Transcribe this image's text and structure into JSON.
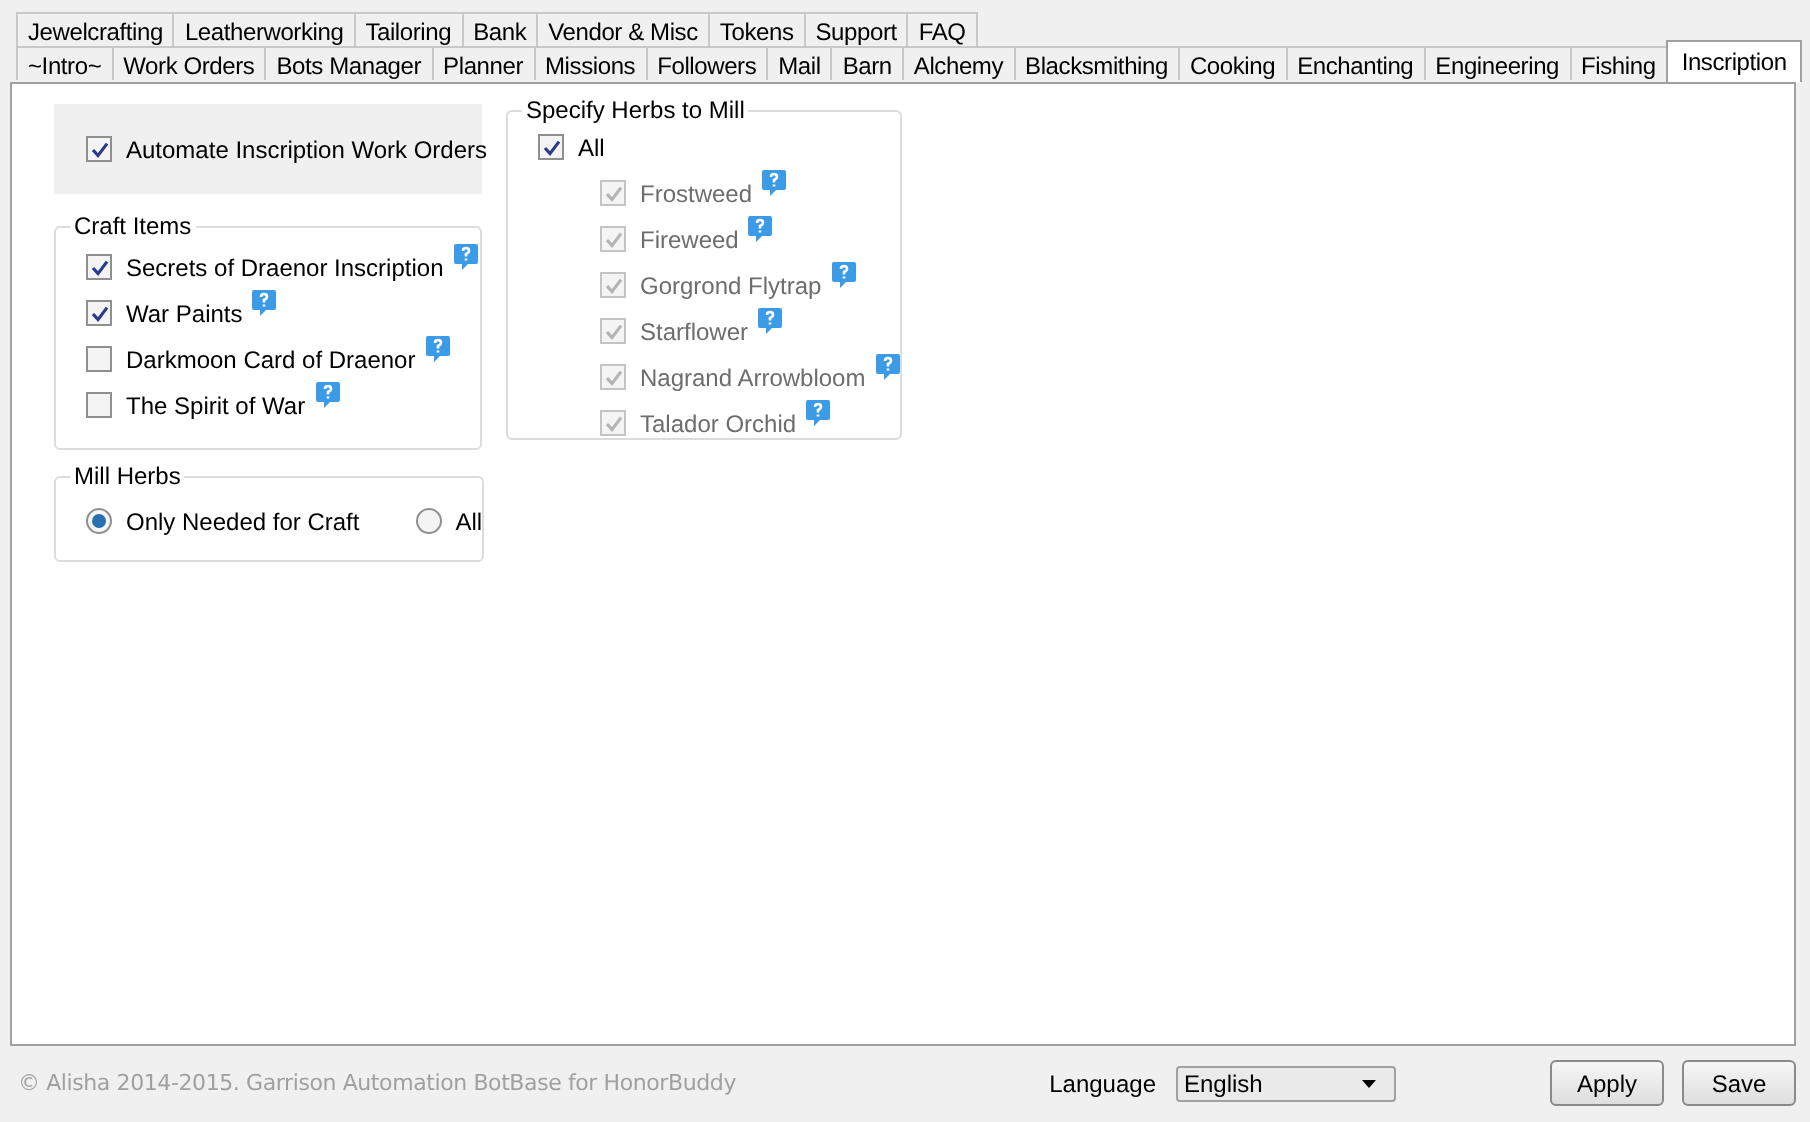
{
  "tab_rows": [
    [
      {
        "label": "Jewelcrafting",
        "selected": false
      },
      {
        "label": "Leatherworking",
        "selected": false
      },
      {
        "label": "Tailoring",
        "selected": false
      },
      {
        "label": "Bank",
        "selected": false
      },
      {
        "label": "Vendor & Misc",
        "selected": false
      },
      {
        "label": "Tokens",
        "selected": false
      },
      {
        "label": "Support",
        "selected": false
      },
      {
        "label": "FAQ",
        "selected": false
      }
    ],
    [
      {
        "label": "~Intro~",
        "selected": false
      },
      {
        "label": "Work Orders",
        "selected": false
      },
      {
        "label": "Bots Manager",
        "selected": false
      },
      {
        "label": "Planner",
        "selected": false
      },
      {
        "label": "Missions",
        "selected": false
      },
      {
        "label": "Followers",
        "selected": false
      },
      {
        "label": "Mail",
        "selected": false
      },
      {
        "label": "Barn",
        "selected": false
      },
      {
        "label": "Alchemy",
        "selected": false
      },
      {
        "label": "Blacksmithing",
        "selected": false
      },
      {
        "label": "Cooking",
        "selected": false
      },
      {
        "label": "Enchanting",
        "selected": false
      },
      {
        "label": "Engineering",
        "selected": false
      },
      {
        "label": "Fishing",
        "selected": false
      },
      {
        "label": "Inscription",
        "selected": true
      }
    ]
  ],
  "automate": {
    "label": "Automate Inscription Work Orders",
    "checked": true
  },
  "craft_items": {
    "title": "Craft Items",
    "items": [
      {
        "label": "Secrets of Draenor Inscription",
        "checked": true
      },
      {
        "label": "War Paints",
        "checked": true
      },
      {
        "label": "Darkmoon Card of Draenor",
        "checked": false
      },
      {
        "label": "The Spirit of War",
        "checked": false
      }
    ]
  },
  "mill_herbs": {
    "title": "Mill Herbs",
    "options": [
      {
        "label": "Only Needed for Craft",
        "selected": true
      },
      {
        "label": "All",
        "selected": false
      }
    ]
  },
  "herbs": {
    "title": "Specify Herbs to Mill",
    "all": {
      "label": "All",
      "checked": true
    },
    "items": [
      {
        "label": "Frostweed",
        "checked": true,
        "disabled": true
      },
      {
        "label": "Fireweed",
        "checked": true,
        "disabled": true
      },
      {
        "label": "Gorgrond Flytrap",
        "checked": true,
        "disabled": true
      },
      {
        "label": "Starflower",
        "checked": true,
        "disabled": true
      },
      {
        "label": "Nagrand Arrowbloom",
        "checked": true,
        "disabled": true
      },
      {
        "label": "Talador Orchid",
        "checked": true,
        "disabled": true
      }
    ]
  },
  "footer": {
    "copyright": "© Alisha 2014-2015. Garrison Automation BotBase for HonorBuddy",
    "language_label": "Language",
    "language": "English",
    "buttons": [
      "Apply",
      "Save"
    ]
  }
}
